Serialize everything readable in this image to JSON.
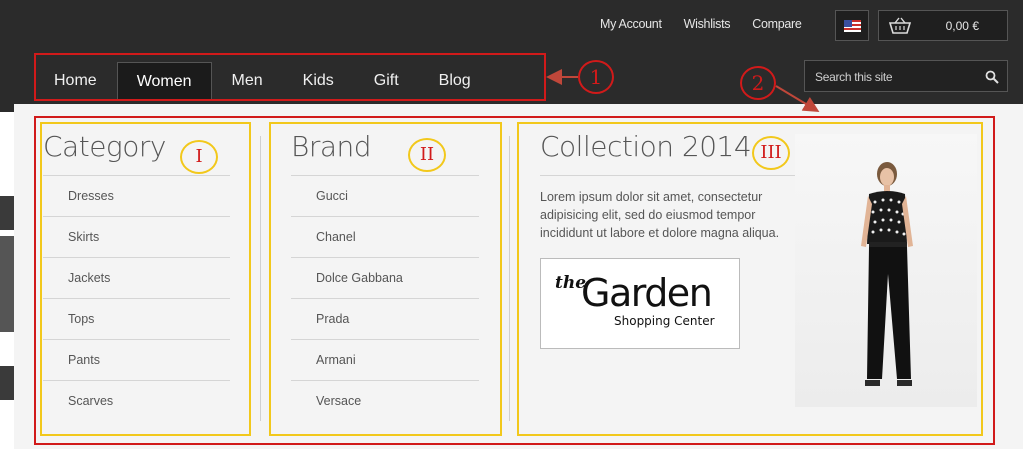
{
  "header": {
    "top_links": [
      "My Account",
      "Wishlists",
      "Compare"
    ],
    "cart_total": "0,00 €",
    "search_placeholder": "Search this site"
  },
  "nav": {
    "items": [
      "Home",
      "Women",
      "Men",
      "Kids",
      "Gift",
      "Blog"
    ],
    "active": "Women"
  },
  "menu": {
    "category": {
      "title": "Category",
      "items": [
        "Dresses",
        "Skirts",
        "Jackets",
        "Tops",
        "Pants",
        "Scarves"
      ]
    },
    "brand": {
      "title": "Brand",
      "items": [
        "Gucci",
        "Chanel",
        "Dolce Gabbana",
        "Prada",
        "Armani",
        "Versace"
      ]
    },
    "collection": {
      "title": "Collection 2014",
      "description": "Lorem ipsum dolor sit amet, consectetur adipisicing elit, sed do eiusmod tempor incididunt ut labore et dolore magna aliqua.",
      "logo_the": "the",
      "logo_name": "Garden",
      "logo_sub": "Shopping Center"
    }
  },
  "annotations": {
    "red": [
      "1",
      "2"
    ],
    "yellow": [
      "I",
      "II",
      "III"
    ],
    "red_color": "#d11a1a",
    "yellow_color": "#f2c81b"
  },
  "icons": [
    "flag-us-icon",
    "cart-icon",
    "search-icon"
  ]
}
